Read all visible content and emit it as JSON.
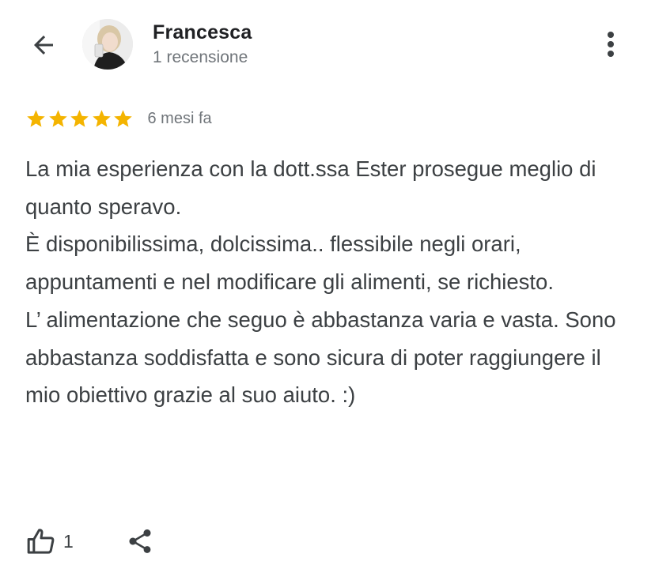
{
  "author": {
    "name": "Francesca",
    "review_count": "1 recensione"
  },
  "icons": {
    "back": "arrow-back-icon",
    "more": "more-vert-icon",
    "star": "star-icon",
    "like": "thumb-up-icon",
    "share": "share-icon"
  },
  "review": {
    "rating": 5,
    "rating_max": 5,
    "date": "6 mesi fa",
    "text": "La mia esperienza con la dott.ssa Ester prosegue meglio di quanto speravo.\nÈ disponibilissima, dolcissima.. flessibile negli orari, appuntamenti e nel modificare gli alimenti, se richiesto.\nL’ alimentazione che seguo è abbastanza varia e vasta. Sono abbastanza soddisfatta e sono sicura di poter raggiungere il mio obiettivo grazie al suo aiuto. :)"
  },
  "actions": {
    "like_count": "1"
  },
  "colors": {
    "star": "#f4b400",
    "icon": "#3c4043",
    "secondary_text": "#70757a"
  }
}
